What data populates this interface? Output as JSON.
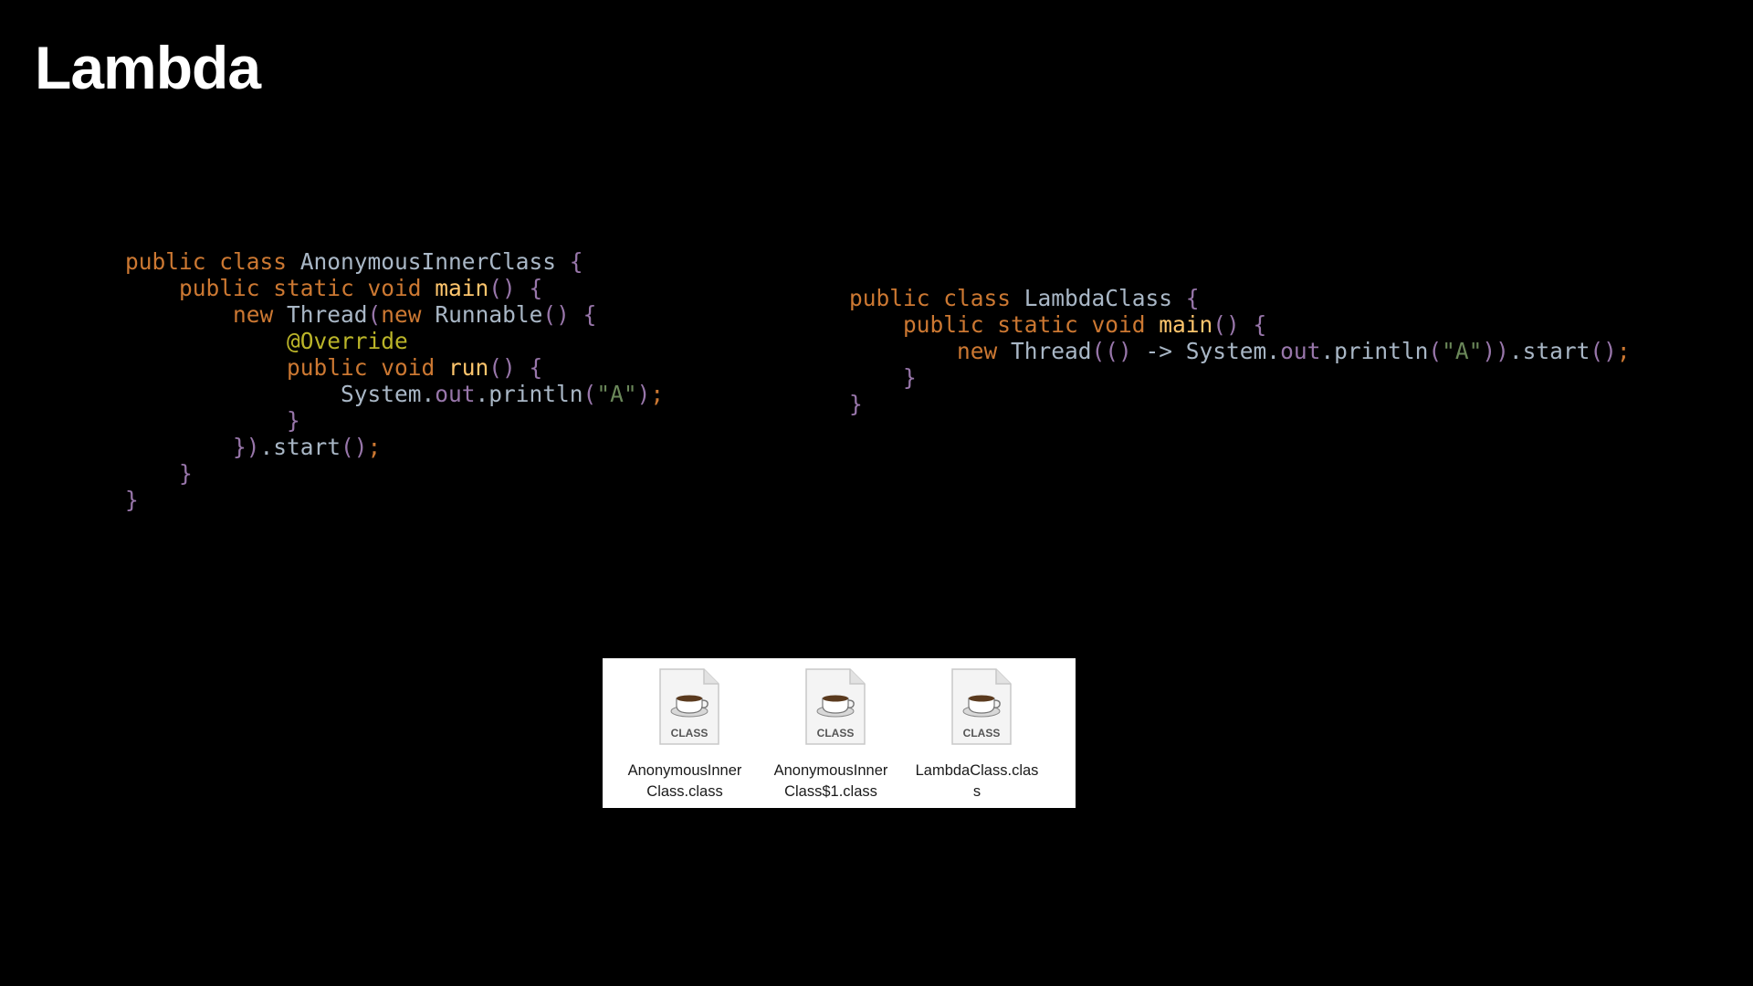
{
  "title": "Lambda",
  "code_left": {
    "lines": [
      [
        {
          "t": "public class ",
          "c": "kw"
        },
        {
          "t": "AnonymousInnerClass ",
          "c": "id"
        },
        {
          "t": "{",
          "c": "pn"
        }
      ],
      [
        {
          "t": "    public static void ",
          "c": "kw"
        },
        {
          "t": "main",
          "c": "fn"
        },
        {
          "t": "() {",
          "c": "pn"
        }
      ],
      [
        {
          "t": "        new ",
          "c": "kw"
        },
        {
          "t": "Thread",
          "c": "id"
        },
        {
          "t": "(",
          "c": "pn"
        },
        {
          "t": "new ",
          "c": "kw"
        },
        {
          "t": "Runnable",
          "c": "id"
        },
        {
          "t": "() {",
          "c": "pn"
        }
      ],
      [
        {
          "t": "            @Override",
          "c": "an"
        }
      ],
      [
        {
          "t": "            public void ",
          "c": "kw"
        },
        {
          "t": "run",
          "c": "fn"
        },
        {
          "t": "() {",
          "c": "pn"
        }
      ],
      [
        {
          "t": "                System.",
          "c": "id"
        },
        {
          "t": "out",
          "c": "fd"
        },
        {
          "t": ".println",
          "c": "id"
        },
        {
          "t": "(",
          "c": "pn"
        },
        {
          "t": "\"A\"",
          "c": "st"
        },
        {
          "t": ")",
          "c": "pn"
        },
        {
          "t": ";",
          "c": "sc"
        }
      ],
      [
        {
          "t": "            }",
          "c": "pn"
        }
      ],
      [
        {
          "t": "        })",
          "c": "pn"
        },
        {
          "t": ".start",
          "c": "id"
        },
        {
          "t": "()",
          "c": "pn"
        },
        {
          "t": ";",
          "c": "sc"
        }
      ],
      [
        {
          "t": "    }",
          "c": "pn"
        }
      ],
      [
        {
          "t": "}",
          "c": "pn"
        }
      ]
    ]
  },
  "code_right": {
    "lines": [
      [
        {
          "t": "public class ",
          "c": "kw"
        },
        {
          "t": "LambdaClass ",
          "c": "id"
        },
        {
          "t": "{",
          "c": "pn"
        }
      ],
      [
        {
          "t": "    public static void ",
          "c": "kw"
        },
        {
          "t": "main",
          "c": "fn"
        },
        {
          "t": "() {",
          "c": "pn"
        }
      ],
      [
        {
          "t": "        new ",
          "c": "kw"
        },
        {
          "t": "Thread",
          "c": "id"
        },
        {
          "t": "(() ",
          "c": "pn"
        },
        {
          "t": "-> System.",
          "c": "id"
        },
        {
          "t": "out",
          "c": "fd"
        },
        {
          "t": ".println",
          "c": "id"
        },
        {
          "t": "(",
          "c": "pn"
        },
        {
          "t": "\"A\"",
          "c": "st"
        },
        {
          "t": "))",
          "c": "pn"
        },
        {
          "t": ".start",
          "c": "id"
        },
        {
          "t": "()",
          "c": "pn"
        },
        {
          "t": ";",
          "c": "sc"
        }
      ],
      [
        {
          "t": "    }",
          "c": "pn"
        }
      ],
      [
        {
          "t": "}",
          "c": "pn"
        }
      ]
    ]
  },
  "files": [
    {
      "icon": "java-class-file-icon",
      "icon_label": "CLASS",
      "name": "AnonymousInner\nClass.class"
    },
    {
      "icon": "java-class-file-icon",
      "icon_label": "CLASS",
      "name": "AnonymousInner\nClass$1.class"
    },
    {
      "icon": "java-class-file-icon",
      "icon_label": "CLASS",
      "name": "LambdaClass.clas\ns"
    }
  ],
  "colors": {
    "background": "#000000",
    "title": "#ffffff",
    "keyword": "#cc7832",
    "identifier": "#a9b7c6",
    "method": "#ffc66d",
    "punctuation": "#9876aa",
    "annotation": "#bbb529",
    "string": "#6a8759"
  }
}
